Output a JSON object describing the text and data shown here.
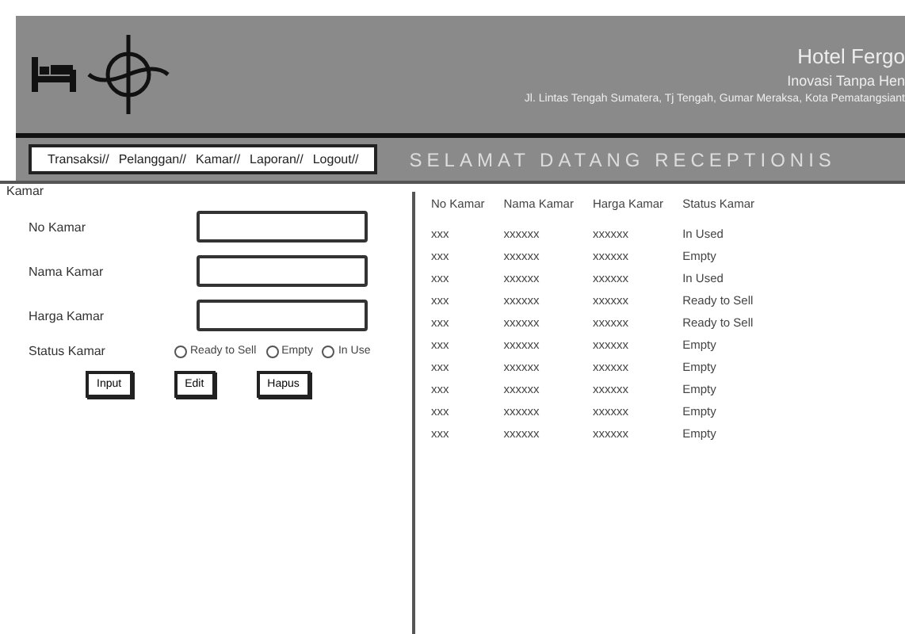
{
  "header": {
    "hotel_name": "Hotel Fergo",
    "tagline": "Inovasi Tanpa Hen",
    "address": "Jl. Lintas Tengah Sumatera, Tj Tengah, Gumar Meraksa, Kota Pematangsiant"
  },
  "menu": [
    "Transaksi//",
    "Pelanggan//",
    "Kamar//",
    "Laporan//",
    "Logout//"
  ],
  "banner": "SELAMAT DATANG RECEPTIONIS",
  "form": {
    "legend": "Kamar",
    "fields": [
      {
        "label": "No Kamar"
      },
      {
        "label": "Nama Kamar"
      },
      {
        "label": "Harga Kamar"
      }
    ],
    "status": {
      "label": "Status Kamar",
      "options": [
        {
          "label": "Ready to Sell",
          "selected": false
        },
        {
          "label": "Empty",
          "selected": false
        },
        {
          "label": "In Use",
          "selected": false
        }
      ]
    },
    "buttons": [
      "Input",
      "Edit",
      "Hapus"
    ]
  },
  "table": {
    "columns": [
      "No Kamar",
      "Nama Kamar",
      "Harga Kamar",
      "Status Kamar"
    ],
    "rows": [
      [
        "xxx",
        "xxxxxx",
        "xxxxxx",
        "In Used"
      ],
      [
        "xxx",
        "xxxxxx",
        "xxxxxx",
        "Empty"
      ],
      [
        "xxx",
        "xxxxxx",
        "xxxxxx",
        "In Used"
      ],
      [
        "xxx",
        "xxxxxx",
        "xxxxxx",
        "Ready to Sell"
      ],
      [
        "xxx",
        "xxxxxx",
        "xxxxxx",
        "Ready to Sell"
      ],
      [
        "xxx",
        "xxxxxx",
        "xxxxxx",
        "Empty"
      ],
      [
        "xxx",
        "xxxxxx",
        "xxxxxx",
        "Empty"
      ],
      [
        "xxx",
        "xxxxxx",
        "xxxxxx",
        "Empty"
      ],
      [
        "xxx",
        "xxxxxx",
        "xxxxxx",
        "Empty"
      ],
      [
        "xxx",
        "xxxxxx",
        "xxxxxx",
        "Empty"
      ]
    ]
  }
}
